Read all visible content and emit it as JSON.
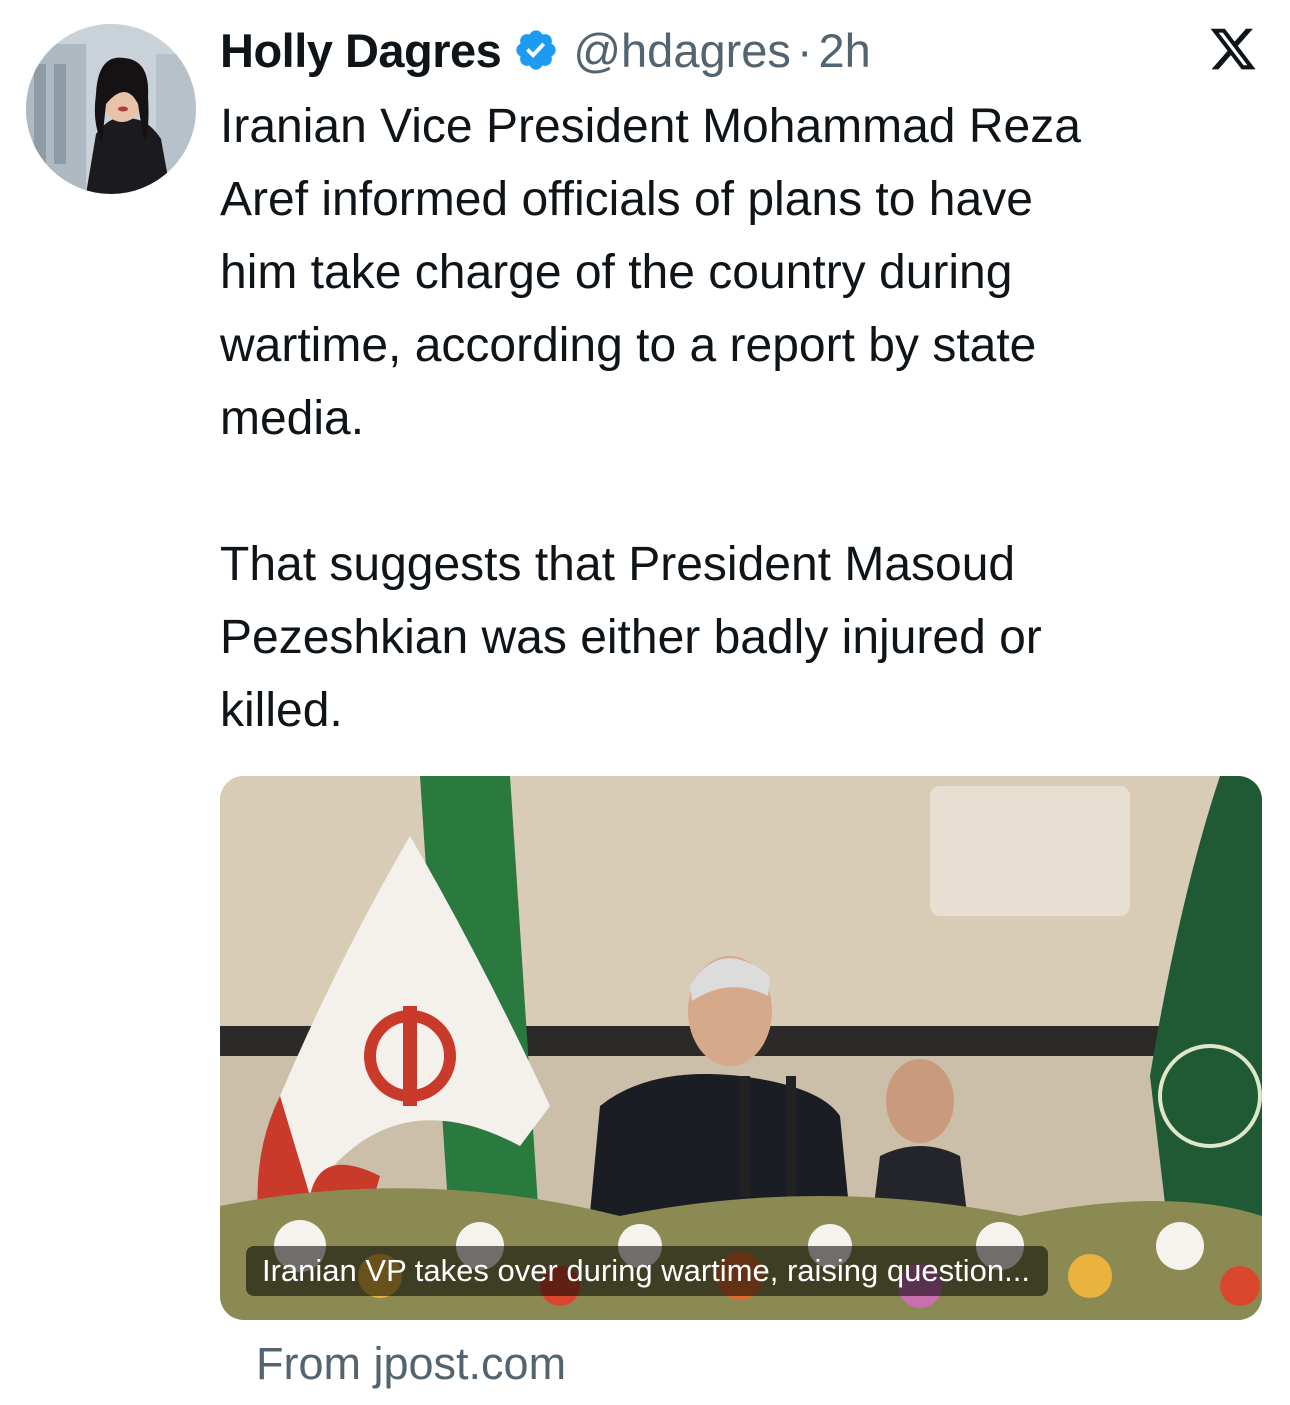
{
  "tweet": {
    "author_name": "Holly Dagres",
    "handle": "@hdagres",
    "separator": "·",
    "time": "2h",
    "text": "Iranian Vice President Mohammad Reza\nAref informed officials of plans to have\nhim take charge of the country during\nwartime, according to a report by state\nmedia.\n\nThat suggests that President Masoud\nPezeshkian was either badly injured or\nkilled."
  },
  "card": {
    "caption": "Iranian VP takes over during wartime, raising question...",
    "source": "From jpost.com"
  },
  "icons": {
    "verified": "verified-badge-icon",
    "platform": "x-logo-icon"
  },
  "colors": {
    "text": "#0f1419",
    "secondary": "#536471",
    "verified": "#1d9bf0"
  }
}
